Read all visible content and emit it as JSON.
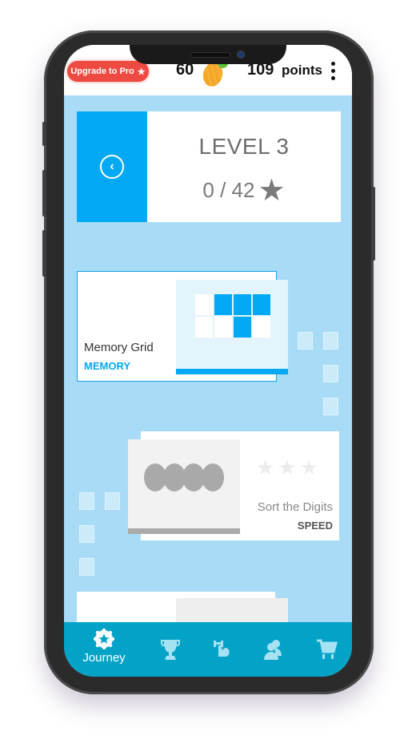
{
  "topbar": {
    "upgrade_label": "Upgrade to Pro",
    "upgrade_icon": "star-icon",
    "coins": "60",
    "coin_icon": "coin-icon",
    "coin_badge": "+",
    "points_value": "109",
    "points_label": "points",
    "menu_icon": "more-vert-icon"
  },
  "level": {
    "title": "LEVEL 3",
    "progress": "0 / 42",
    "back_icon": "chevron-left-circle-icon",
    "star_icon": "star-icon"
  },
  "games": [
    {
      "name": "Memory Grid",
      "category": "MEMORY",
      "category_color": "#03a9f4",
      "grid": [
        false,
        true,
        true,
        true,
        false,
        false,
        true,
        false
      ]
    },
    {
      "name": "Sort the Digits",
      "category": "SPEED",
      "category_color": "#555555",
      "stars": "★★★",
      "stars_earned": 0
    }
  ],
  "nav": {
    "items": [
      {
        "label": "Journey",
        "icon": "journey-badge-icon",
        "active": true
      },
      {
        "label": "",
        "icon": "trophy-icon",
        "active": false
      },
      {
        "label": "",
        "icon": "workout-icon",
        "active": false
      },
      {
        "label": "",
        "icon": "friends-icon",
        "active": false
      },
      {
        "label": "",
        "icon": "cart-icon",
        "active": false
      }
    ]
  },
  "colors": {
    "accent": "#03a9f4",
    "background": "#a8dcf6",
    "nav": "#03a3c8",
    "upgrade": "#ef4a42"
  }
}
